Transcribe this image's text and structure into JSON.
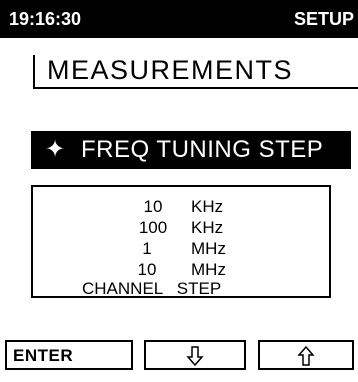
{
  "header": {
    "time": "19:16:30",
    "mode": "SETUP"
  },
  "menu": {
    "title": "MEASUREMENTS",
    "selected_icon": "star-diamond-icon",
    "selected_glyph": "✦",
    "selected_label": "FREQ TUNING STEP"
  },
  "options": [
    {
      "value": "10",
      "unit": "KHz"
    },
    {
      "value": "100",
      "unit": "KHz"
    },
    {
      "value": "1",
      "unit": "MHz"
    },
    {
      "value": "10",
      "unit": "MHz"
    },
    {
      "label": "CHANNEL   STEP"
    }
  ],
  "softkeys": {
    "enter_label": "ENTER",
    "down_icon": "arrow-down-outline-icon",
    "up_icon": "arrow-up-outline-icon"
  }
}
